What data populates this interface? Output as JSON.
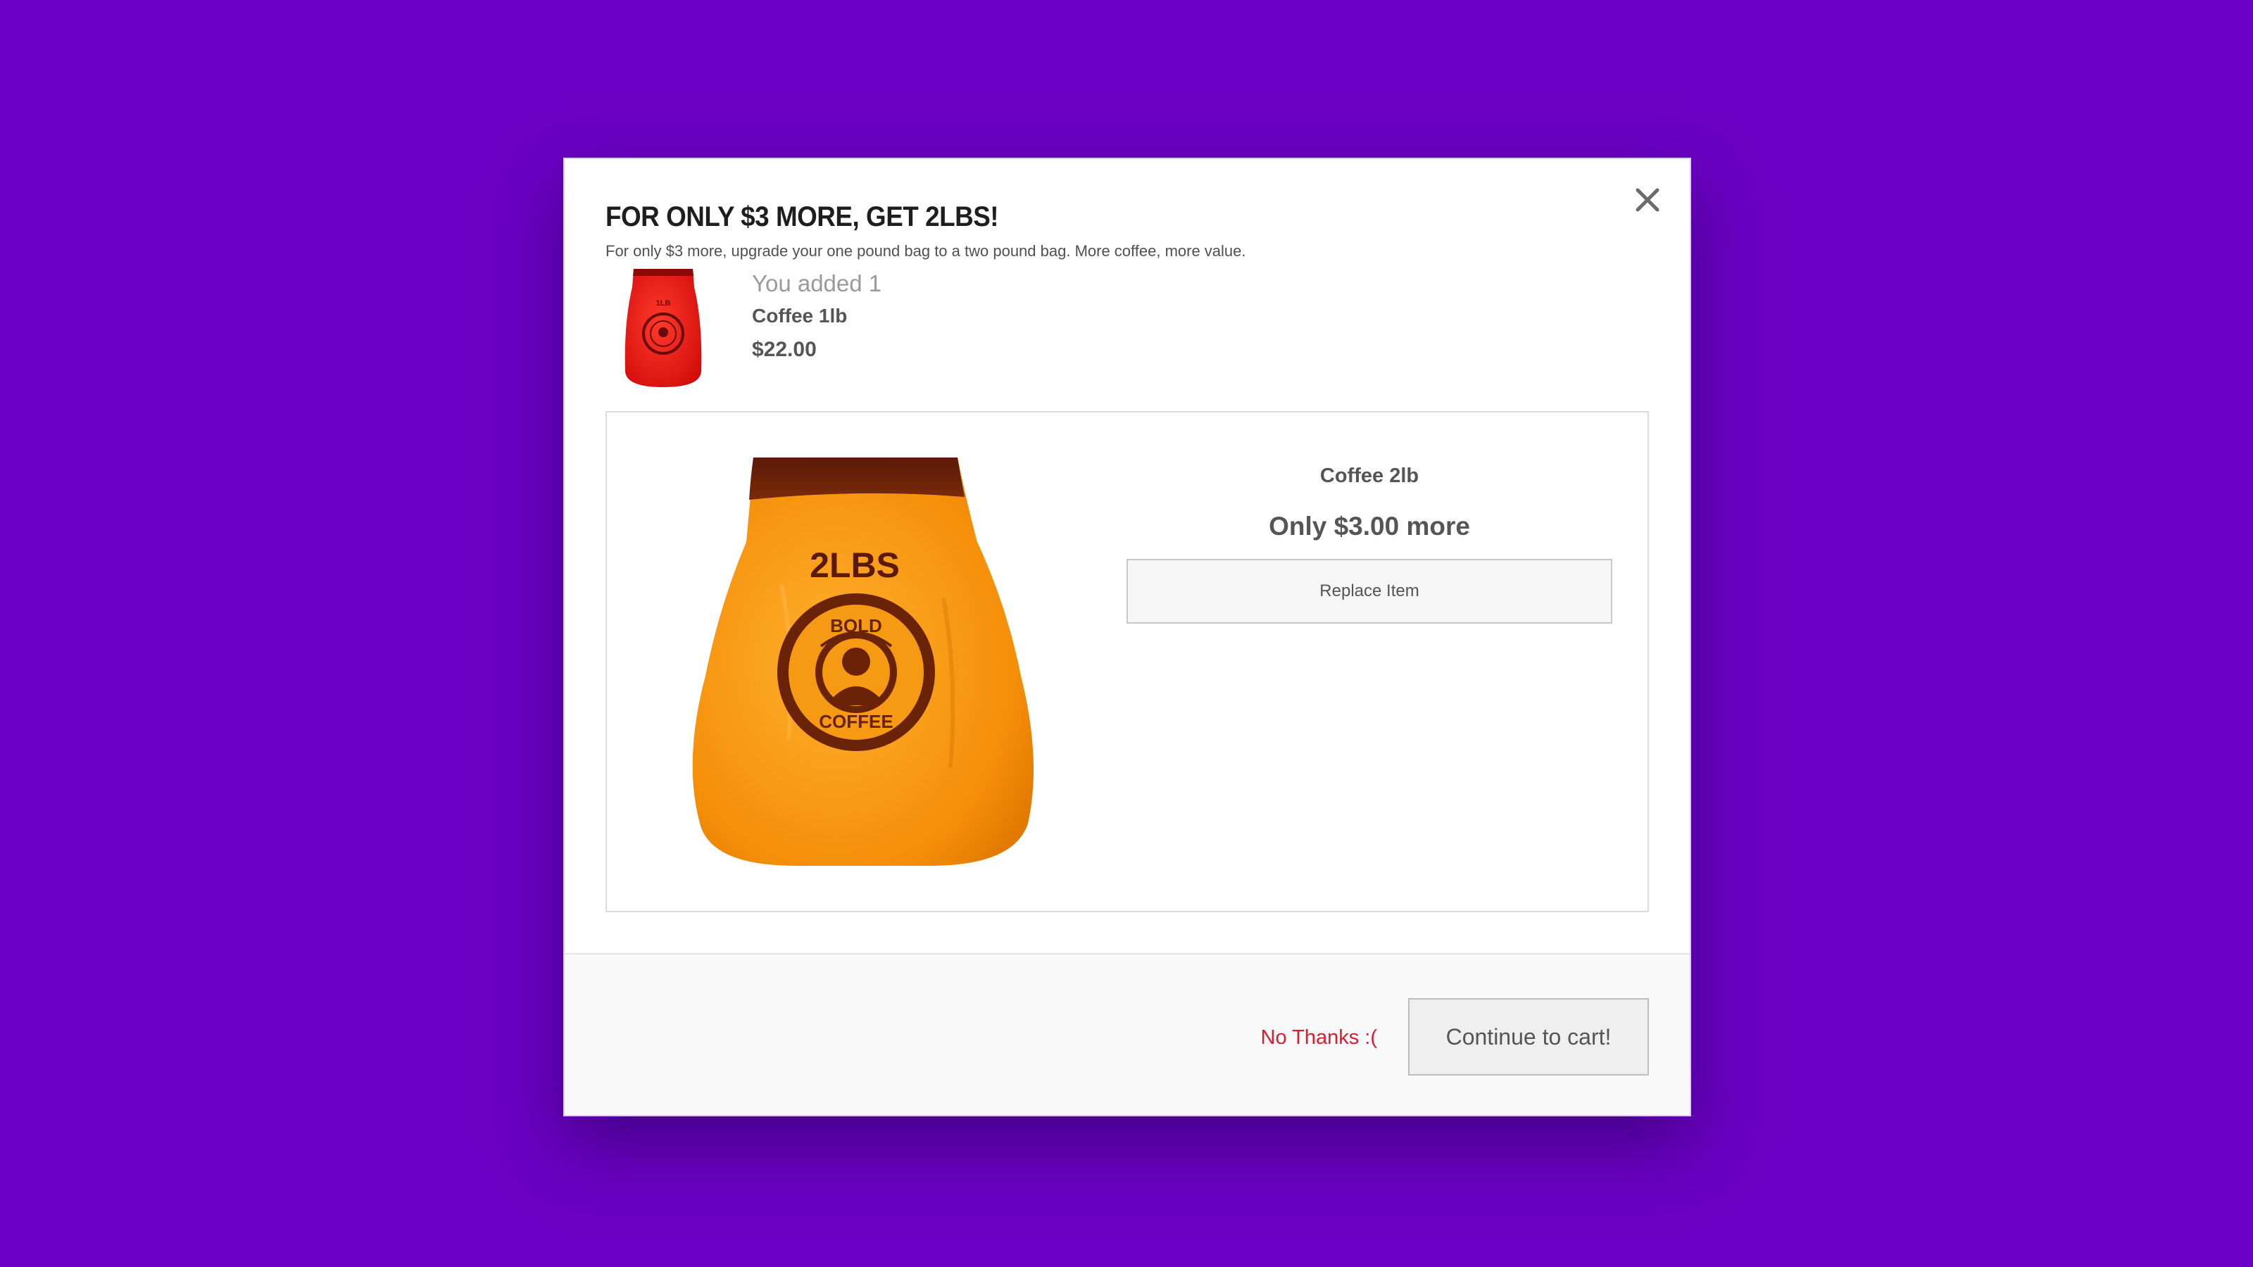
{
  "modal": {
    "headline": "FOR ONLY $3 MORE, GET 2LBS!",
    "subline": "For only $3 more, upgrade your one pound bag to a two pound bag. More coffee, more value.",
    "close_icon": "close-icon"
  },
  "added_item": {
    "label": "You added 1",
    "name": "Coffee 1lb",
    "price": "$22.00",
    "bag_label": "1LB",
    "bag_color": "#ff1a12"
  },
  "offer": {
    "name": "Coffee 2lb",
    "price_text": "Only $3.00 more",
    "button_label": "Replace Item",
    "bag_label": "2LBS",
    "logo_top": "BOLD",
    "logo_bottom": "COFFEE",
    "bag_color": "#ff9a12"
  },
  "footer": {
    "no_thanks_label": "No Thanks :(",
    "continue_label": "Continue to cart!"
  },
  "colors": {
    "background": "#6a00c3",
    "decline": "#e0192e"
  }
}
